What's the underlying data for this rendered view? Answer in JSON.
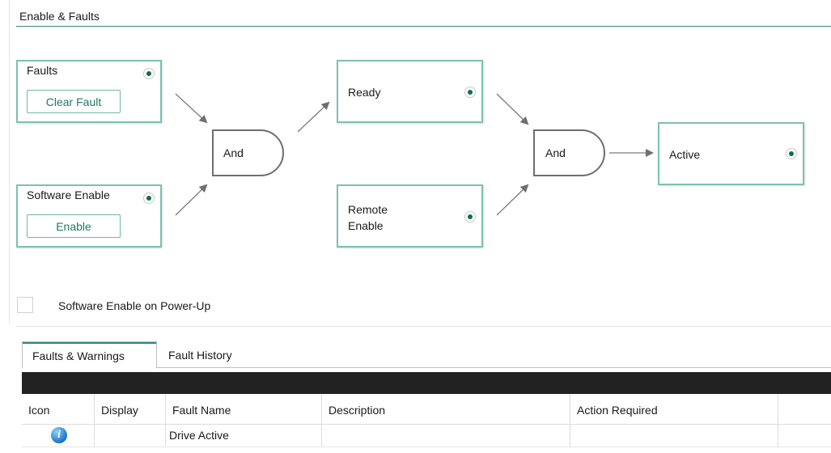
{
  "section": {
    "title": "Enable & Faults"
  },
  "nodes": {
    "faults": {
      "label": "Faults",
      "button": "Clear Fault"
    },
    "software_enable": {
      "label": "Software Enable",
      "button": "Enable"
    },
    "ready": {
      "label": "Ready"
    },
    "remote_enable": {
      "label": "Remote\nEnable"
    },
    "active": {
      "label": "Active"
    }
  },
  "gates": {
    "gate1": "And",
    "gate2": "And"
  },
  "indicator_color": "#0e6e55",
  "accent_color": "#2e8b75",
  "power_up": {
    "label": "Software Enable on Power-Up",
    "checked": false
  },
  "tabs": [
    {
      "label": "Faults & Warnings",
      "active": true
    },
    {
      "label": "Fault History",
      "active": false
    }
  ],
  "table": {
    "columns": [
      "Icon",
      "Display",
      "Fault Name",
      "Description",
      "Action Required",
      ""
    ],
    "rows": [
      {
        "icon": "info-icon",
        "display": "",
        "fault_name": "Drive Active",
        "description": "",
        "action_required": ""
      }
    ]
  }
}
